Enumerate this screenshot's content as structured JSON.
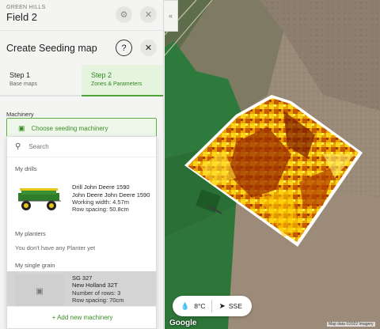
{
  "field": {
    "farm": "GREEN HILLS",
    "name": "Field 2"
  },
  "seeding": {
    "title": "Create Seeding map"
  },
  "steps": [
    {
      "title": "Step 1",
      "subtitle": "Base maps"
    },
    {
      "title": "Step 2",
      "subtitle": "Zones & Parameters"
    }
  ],
  "machinery": {
    "label": "Machinery",
    "choose_label": "Choose seeding machinery",
    "search_placeholder": "Search",
    "drills_label": "My drills",
    "drill": {
      "name1": "Drill John Deere 1590",
      "name2": "John Deere John Deere 1590",
      "width": "Working width: 4.57m",
      "spacing": "Row spacing: 50.8cm"
    },
    "planters_label": "My planters",
    "planters_empty": "You don't have any Planter yet",
    "single_label": "My single grain",
    "single": {
      "name1": "SG 327",
      "name2": "New Holland 32T",
      "rows": "Number of rows: 3",
      "spacing": "Row spacing: 70cm"
    },
    "add_label": "+ Add new machinery"
  },
  "weather": {
    "temp": "8°C",
    "wind": "SSE"
  },
  "map": {
    "google": "Google",
    "attribution": "Map data ©2022 Imagery"
  },
  "icons": {
    "gear": "gear-icon",
    "close": "close-icon",
    "help": "help-icon",
    "search": "search-icon",
    "collapse": "chevron-left-icon",
    "drop": "droplet-icon",
    "wind": "wind-arrow-icon",
    "tractor": "tractor-icon"
  },
  "colors": {
    "accent": "#4ea43a",
    "zone_dark": "#7a1a00",
    "zone_light": "#ffe030"
  }
}
